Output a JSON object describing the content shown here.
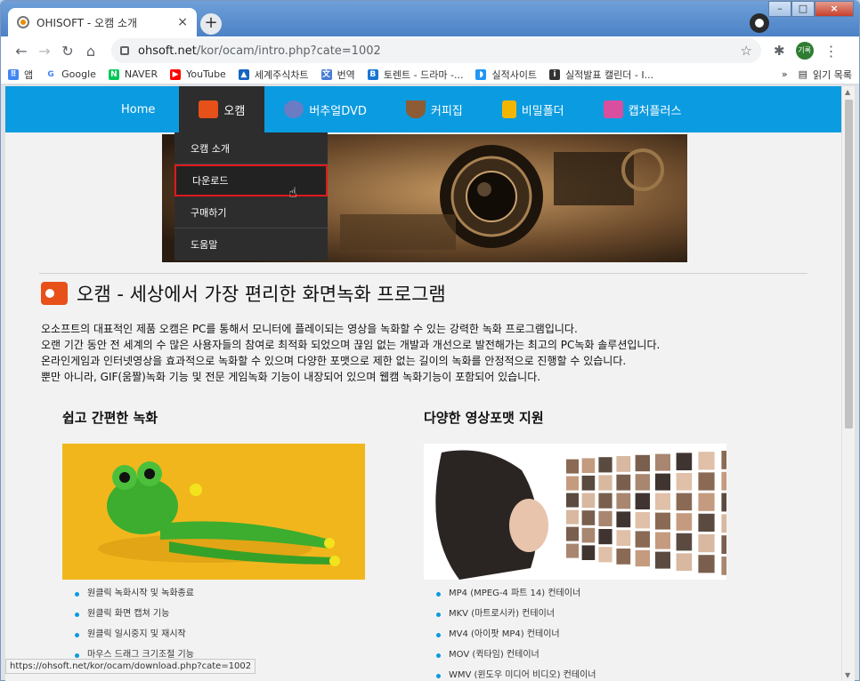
{
  "browser": {
    "tab_title": "OHISOFT - 오캠 소개",
    "tab_close": "×",
    "new_tab": "+",
    "url_host": "ohsoft.net",
    "url_path": "/kor/ocam/intro.php?cate=1002",
    "status_url": "https://ohsoft.net/kor/ocam/download.php?cate=1002",
    "avatar_text": "기록"
  },
  "bookmarks": {
    "items": [
      {
        "label": "앱",
        "icon": "apps-grid-icon",
        "color": "#4285f4"
      },
      {
        "label": "Google",
        "icon": "google-icon",
        "color": "#4285f4"
      },
      {
        "label": "NAVER",
        "icon": "naver-icon",
        "color": "#03c75a"
      },
      {
        "label": "YouTube",
        "icon": "youtube-icon",
        "color": "#ff0000"
      },
      {
        "label": "세계주식차트",
        "icon": "chart-icon",
        "color": "#1565c0"
      },
      {
        "label": "번역",
        "icon": "translate-icon",
        "color": "#4a7bd6"
      },
      {
        "label": "토렌트 - 드라마 -...",
        "icon": "bookmark-b-icon",
        "color": "#1976d2"
      },
      {
        "label": "실적사이트",
        "icon": "site-icon",
        "color": "#2196f3"
      },
      {
        "label": "실적발표 캘린더 - I...",
        "icon": "inv-icon",
        "color": "#333333"
      }
    ],
    "more": "»",
    "reading_list": "읽기 목록"
  },
  "site_nav": {
    "items": [
      {
        "label": "Home",
        "icon": ""
      },
      {
        "label": "오캠",
        "icon": "ocam-icon",
        "color": "#e8501a"
      },
      {
        "label": "버추얼DVD",
        "icon": "dvd-icon",
        "color": "#6a7cc4"
      },
      {
        "label": "커피집",
        "icon": "coffee-icon",
        "color": "#8d5b34"
      },
      {
        "label": "비밀폴더",
        "icon": "lock-icon",
        "color": "#f2b600"
      },
      {
        "label": "캡처플러스",
        "icon": "capture-icon",
        "color": "#d94f9f"
      }
    ]
  },
  "dropdown": {
    "items": [
      "오캠 소개",
      "다운로드",
      "구매하기",
      "도움말"
    ]
  },
  "page": {
    "title": "오캠 - 세상에서 가장 편리한 화면녹화 프로그램",
    "intro": [
      "오소프트의 대표적인 제품 오캠은 PC를 통해서 모니터에 플레이되는 영상을 녹화할 수 있는 강력한 녹화 프로그램입니다.",
      "오랜 기간 동안 전 세계의 수 많은 사용자들의 참여로 최적화 되었으며 끊임 없는 개발과 개선으로 발전해가는 최고의 PC녹화 솔루션입니다.",
      "온라인게임과 인터넷영상을 효과적으로 녹화할 수 있으며 다양한 포맷으로 제한 없는 길이의 녹화를 안정적으로 진행할 수 있습니다.",
      "뿐만 아니라, GIF(움짤)녹화 기능 및 전문 게임녹화 기능이 내장되어 있으며 웹캠 녹화기능이 포함되어 있습니다."
    ],
    "left_col": {
      "heading": "쉽고 간편한 녹화",
      "features": [
        "원클릭 녹화시작 및 녹화종료",
        "원클릭 화면 캡쳐 기능",
        "원클릭 일시중지 및 재시작",
        "마우스 드래그 크기조절 기능"
      ]
    },
    "right_col": {
      "heading": "다양한 영상포맷 지원",
      "features": [
        "MP4 (MPEG-4 파트 14) 컨테이너",
        "MKV (마트로시카) 컨테이너",
        "MV4 (아이팟 MP4) 컨테이너",
        "MOV (퀵타임) 컨테이너",
        "WMV (윈도우 미디어 비디오) 컨테이너"
      ]
    }
  }
}
